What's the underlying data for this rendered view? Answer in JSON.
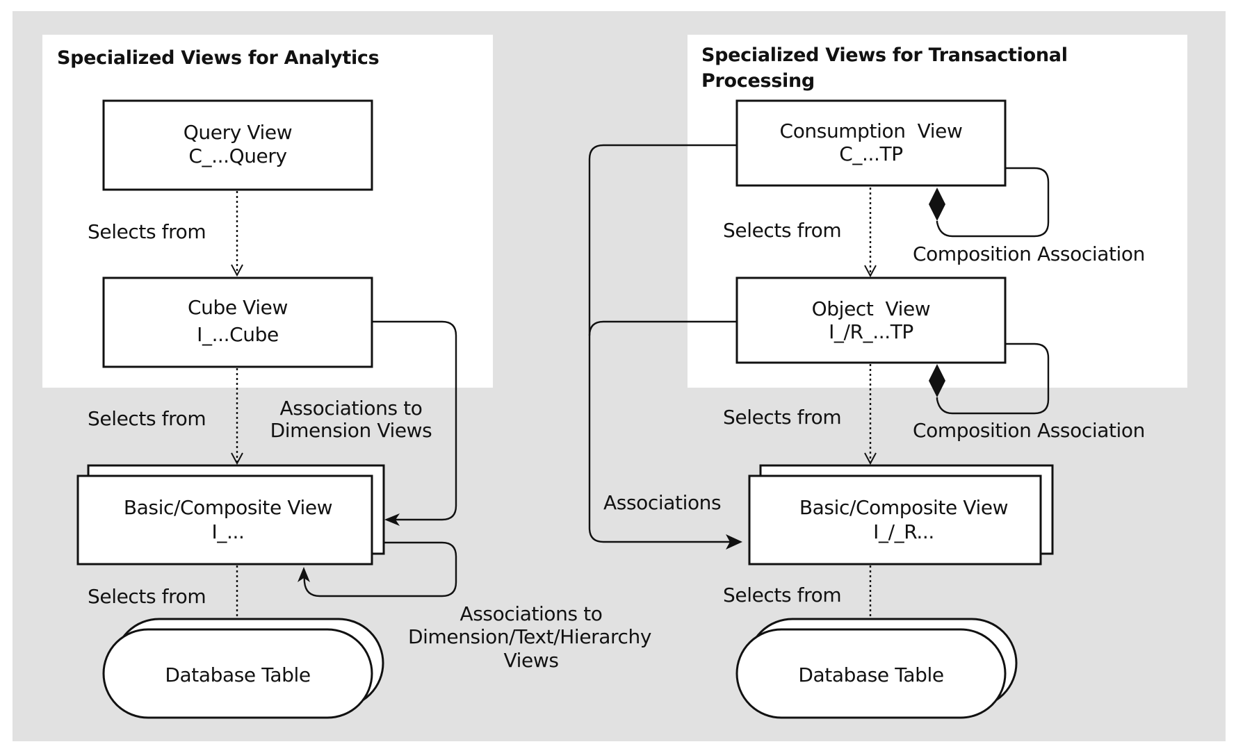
{
  "colors": {
    "background_outer": "#ffffff",
    "canvas": "#e1e1e1",
    "panel": "#ffffff",
    "stroke": "#111111",
    "text": "#111111"
  },
  "analytics": {
    "title": "Specialized Views for Analytics",
    "query_view": {
      "name": "Query View",
      "prefix": "C_...Query"
    },
    "cube_view": {
      "name": "Cube View",
      "prefix": "I_...Cube"
    },
    "basic_view": {
      "name": "Basic/Composite View",
      "prefix": "I_..."
    },
    "database_table": {
      "name": "Database Table"
    },
    "edges": {
      "query_to_cube": "Selects from",
      "cube_to_basic": "Selects from",
      "basic_to_table": "Selects from",
      "cube_assoc": {
        "line1": "Associations to",
        "line2": "Dimension Views"
      },
      "basic_assoc": {
        "line1": "Associations to",
        "line2": "Dimension/Text/Hierarchy",
        "line3": "Views"
      }
    }
  },
  "transactional": {
    "title_line1": "Specialized Views for Transactional",
    "title_line2": "Processing",
    "consumption_view": {
      "name": "Consumption  View",
      "prefix": "C_...TP"
    },
    "object_view": {
      "name": "Object  View",
      "prefix": "I_/R_...TP"
    },
    "basic_view": {
      "name": "Basic/Composite View",
      "prefix": "I_/_R..."
    },
    "database_table": {
      "name": "Database Table"
    },
    "edges": {
      "consumption_to_object": "Selects from",
      "object_to_basic": "Selects from",
      "basic_to_table": "Selects from",
      "consumption_composition": "Composition Association",
      "object_composition": "Composition Association",
      "associations": "Associations"
    }
  }
}
